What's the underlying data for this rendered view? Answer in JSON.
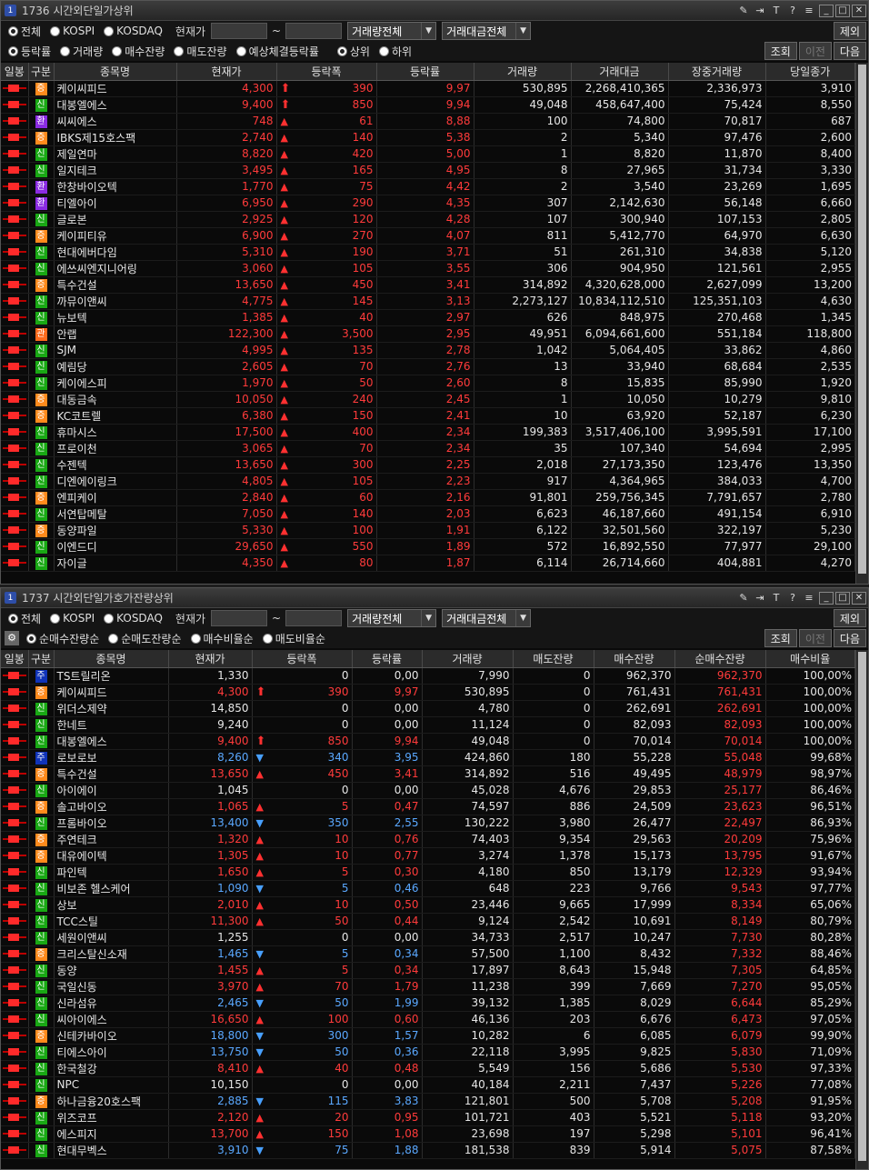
{
  "top": {
    "num": "1",
    "title": "1736 시간외단일가상위",
    "radios": [
      "전체",
      "KOSPI",
      "KOSDAQ"
    ],
    "price_label": "현재가",
    "tilde": "~",
    "sel1": "거래량전체",
    "sel2": "거래대금전체",
    "btn_exclude": "제외",
    "radios2": [
      "등락률",
      "거래량",
      "매수잔량",
      "매도잔량",
      "예상체결등락률"
    ],
    "radios3": [
      "상위",
      "하위"
    ],
    "btn_query": "조회",
    "btn_prev": "이전",
    "btn_next": "다음",
    "headers": [
      "일봉",
      "구분",
      "종목명",
      "현재가",
      "등락폭",
      "등락률",
      "거래량",
      "거래대금",
      "장중거래량",
      "당일종가"
    ],
    "rows": [
      [
        "증",
        "케이씨피드",
        "4,300",
        "up2",
        "390",
        "9,97",
        "530,895",
        "2,268,410,365",
        "2,336,973",
        "3,910"
      ],
      [
        "신",
        "대봉엘에스",
        "9,400",
        "up2",
        "850",
        "9,94",
        "49,048",
        "458,647,400",
        "75,424",
        "8,550"
      ],
      [
        "환",
        "씨씨에스",
        "748",
        "up",
        "61",
        "8,88",
        "100",
        "74,800",
        "70,817",
        "687"
      ],
      [
        "증",
        "IBKS제15호스팩",
        "2,740",
        "up",
        "140",
        "5,38",
        "2",
        "5,340",
        "97,476",
        "2,600"
      ],
      [
        "신",
        "제일연마",
        "8,820",
        "up",
        "420",
        "5,00",
        "1",
        "8,820",
        "11,870",
        "8,400"
      ],
      [
        "신",
        "일지테크",
        "3,495",
        "up",
        "165",
        "4,95",
        "8",
        "27,965",
        "31,734",
        "3,330"
      ],
      [
        "환",
        "한창바이오텍",
        "1,770",
        "up",
        "75",
        "4,42",
        "2",
        "3,540",
        "23,269",
        "1,695"
      ],
      [
        "환",
        "티엘아이",
        "6,950",
        "up",
        "290",
        "4,35",
        "307",
        "2,142,630",
        "56,148",
        "6,660"
      ],
      [
        "신",
        "글로본",
        "2,925",
        "up",
        "120",
        "4,28",
        "107",
        "300,940",
        "107,153",
        "2,805"
      ],
      [
        "증",
        "케이피티유",
        "6,900",
        "up",
        "270",
        "4,07",
        "811",
        "5,412,770",
        "64,970",
        "6,630"
      ],
      [
        "신",
        "현대에버다임",
        "5,310",
        "up",
        "190",
        "3,71",
        "51",
        "261,310",
        "34,838",
        "5,120"
      ],
      [
        "신",
        "에쓰씨엔지니어링",
        "3,060",
        "up",
        "105",
        "3,55",
        "306",
        "904,950",
        "121,561",
        "2,955"
      ],
      [
        "증",
        "특수건설",
        "13,650",
        "up",
        "450",
        "3,41",
        "314,892",
        "4,320,628,000",
        "2,627,099",
        "13,200"
      ],
      [
        "신",
        "까뮤이앤씨",
        "4,775",
        "up",
        "145",
        "3,13",
        "2,273,127",
        "10,834,112,510",
        "125,351,103",
        "4,630"
      ],
      [
        "신",
        "뉴보텍",
        "1,385",
        "up",
        "40",
        "2,97",
        "626",
        "848,975",
        "270,468",
        "1,345"
      ],
      [
        "관",
        "안랩",
        "122,300",
        "up",
        "3,500",
        "2,95",
        "49,951",
        "6,094,661,600",
        "551,184",
        "118,800"
      ],
      [
        "신",
        "SJM",
        "4,995",
        "up",
        "135",
        "2,78",
        "1,042",
        "5,064,405",
        "33,862",
        "4,860"
      ],
      [
        "신",
        "예림당",
        "2,605",
        "up",
        "70",
        "2,76",
        "13",
        "33,940",
        "68,684",
        "2,535"
      ],
      [
        "신",
        "케이에스피",
        "1,970",
        "up",
        "50",
        "2,60",
        "8",
        "15,835",
        "85,990",
        "1,920"
      ],
      [
        "증",
        "대동금속",
        "10,050",
        "up",
        "240",
        "2,45",
        "1",
        "10,050",
        "10,279",
        "9,810"
      ],
      [
        "증",
        "KC코트렐",
        "6,380",
        "up",
        "150",
        "2,41",
        "10",
        "63,920",
        "52,187",
        "6,230"
      ],
      [
        "신",
        "휴마시스",
        "17,500",
        "up",
        "400",
        "2,34",
        "199,383",
        "3,517,406,100",
        "3,995,591",
        "17,100"
      ],
      [
        "신",
        "프로이천",
        "3,065",
        "up",
        "70",
        "2,34",
        "35",
        "107,340",
        "54,694",
        "2,995"
      ],
      [
        "신",
        "수젠텍",
        "13,650",
        "up",
        "300",
        "2,25",
        "2,018",
        "27,173,350",
        "123,476",
        "13,350"
      ],
      [
        "신",
        "디엔에이링크",
        "4,805",
        "up",
        "105",
        "2,23",
        "917",
        "4,364,965",
        "384,033",
        "4,700"
      ],
      [
        "증",
        "엔피케이",
        "2,840",
        "up",
        "60",
        "2,16",
        "91,801",
        "259,756,345",
        "7,791,657",
        "2,780"
      ],
      [
        "신",
        "서연탑메탈",
        "7,050",
        "up",
        "140",
        "2,03",
        "6,623",
        "46,187,660",
        "491,154",
        "6,910"
      ],
      [
        "증",
        "동양파일",
        "5,330",
        "up",
        "100",
        "1,91",
        "6,122",
        "32,501,560",
        "322,197",
        "5,230"
      ],
      [
        "신",
        "이엔드디",
        "29,650",
        "up",
        "550",
        "1,89",
        "572",
        "16,892,550",
        "77,977",
        "29,100"
      ],
      [
        "신",
        "자이글",
        "4,350",
        "up",
        "80",
        "1,87",
        "6,114",
        "26,714,660",
        "404,881",
        "4,270"
      ]
    ]
  },
  "bottom": {
    "num": "1",
    "title": "1737 시간외단일가호가잔량상위",
    "radios": [
      "전체",
      "KOSPI",
      "KOSDAQ"
    ],
    "price_label": "현재가",
    "tilde": "~",
    "sel1": "거래량전체",
    "sel2": "거래대금전체",
    "btn_exclude": "제외",
    "radios2": [
      "순매수잔량순",
      "순매도잔량순",
      "매수비율순",
      "매도비율순"
    ],
    "btn_query": "조회",
    "btn_prev": "이전",
    "btn_next": "다음",
    "headers": [
      "일봉",
      "구분",
      "종목명",
      "현재가",
      "등락폭",
      "등락률",
      "거래량",
      "매도잔량",
      "매수잔량",
      "순매수잔량",
      "매수비율"
    ],
    "rows": [
      [
        "주",
        "TS트릴리온",
        "1,330",
        "",
        "0",
        "0,00",
        "7,990",
        "0",
        "962,370",
        "962,370",
        "100,00%"
      ],
      [
        "증",
        "케이씨피드",
        "4,300",
        "up2",
        "390",
        "9,97",
        "530,895",
        "0",
        "761,431",
        "761,431",
        "100,00%"
      ],
      [
        "신",
        "위더스제약",
        "14,850",
        "",
        "0",
        "0,00",
        "4,780",
        "0",
        "262,691",
        "262,691",
        "100,00%"
      ],
      [
        "신",
        "한네트",
        "9,240",
        "",
        "0",
        "0,00",
        "11,124",
        "0",
        "82,093",
        "82,093",
        "100,00%"
      ],
      [
        "신",
        "대봉엘에스",
        "9,400",
        "up2",
        "850",
        "9,94",
        "49,048",
        "0",
        "70,014",
        "70,014",
        "100,00%"
      ],
      [
        "주",
        "로보로보",
        "8,260",
        "dn",
        "340",
        "3,95",
        "424,860",
        "180",
        "55,228",
        "55,048",
        "99,68%"
      ],
      [
        "증",
        "특수건설",
        "13,650",
        "up",
        "450",
        "3,41",
        "314,892",
        "516",
        "49,495",
        "48,979",
        "98,97%"
      ],
      [
        "신",
        "아이에이",
        "1,045",
        "",
        "0",
        "0,00",
        "45,028",
        "4,676",
        "29,853",
        "25,177",
        "86,46%"
      ],
      [
        "증",
        "솔고바이오",
        "1,065",
        "up",
        "5",
        "0,47",
        "74,597",
        "886",
        "24,509",
        "23,623",
        "96,51%"
      ],
      [
        "신",
        "프롬바이오",
        "13,400",
        "dn",
        "350",
        "2,55",
        "130,222",
        "3,980",
        "26,477",
        "22,497",
        "86,93%"
      ],
      [
        "증",
        "주연테크",
        "1,320",
        "up",
        "10",
        "0,76",
        "74,403",
        "9,354",
        "29,563",
        "20,209",
        "75,96%"
      ],
      [
        "증",
        "대유에이텍",
        "1,305",
        "up",
        "10",
        "0,77",
        "3,274",
        "1,378",
        "15,173",
        "13,795",
        "91,67%"
      ],
      [
        "신",
        "파인텍",
        "1,650",
        "up",
        "5",
        "0,30",
        "4,180",
        "850",
        "13,179",
        "12,329",
        "93,94%"
      ],
      [
        "신",
        "비보존 헬스케어",
        "1,090",
        "dn",
        "5",
        "0,46",
        "648",
        "223",
        "9,766",
        "9,543",
        "97,77%"
      ],
      [
        "신",
        "상보",
        "2,010",
        "up",
        "10",
        "0,50",
        "23,446",
        "9,665",
        "17,999",
        "8,334",
        "65,06%"
      ],
      [
        "신",
        "TCC스틸",
        "11,300",
        "up",
        "50",
        "0,44",
        "9,124",
        "2,542",
        "10,691",
        "8,149",
        "80,79%"
      ],
      [
        "신",
        "세원이앤씨",
        "1,255",
        "",
        "0",
        "0,00",
        "34,733",
        "2,517",
        "10,247",
        "7,730",
        "80,28%"
      ],
      [
        "증",
        "크리스탈신소재",
        "1,465",
        "dn",
        "5",
        "0,34",
        "57,500",
        "1,100",
        "8,432",
        "7,332",
        "88,46%"
      ],
      [
        "신",
        "동양",
        "1,455",
        "up",
        "5",
        "0,34",
        "17,897",
        "8,643",
        "15,948",
        "7,305",
        "64,85%"
      ],
      [
        "신",
        "국일신동",
        "3,970",
        "up",
        "70",
        "1,79",
        "11,238",
        "399",
        "7,669",
        "7,270",
        "95,05%"
      ],
      [
        "신",
        "신라섬유",
        "2,465",
        "dn",
        "50",
        "1,99",
        "39,132",
        "1,385",
        "8,029",
        "6,644",
        "85,29%"
      ],
      [
        "신",
        "씨아이에스",
        "16,650",
        "up",
        "100",
        "0,60",
        "46,136",
        "203",
        "6,676",
        "6,473",
        "97,05%"
      ],
      [
        "증",
        "신테카바이오",
        "18,800",
        "dn",
        "300",
        "1,57",
        "10,282",
        "6",
        "6,085",
        "6,079",
        "99,90%"
      ],
      [
        "신",
        "티에스아이",
        "13,750",
        "dn",
        "50",
        "0,36",
        "22,118",
        "3,995",
        "9,825",
        "5,830",
        "71,09%"
      ],
      [
        "신",
        "한국철강",
        "8,410",
        "up",
        "40",
        "0,48",
        "5,549",
        "156",
        "5,686",
        "5,530",
        "97,33%"
      ],
      [
        "신",
        "NPC",
        "10,150",
        "",
        "0",
        "0,00",
        "40,184",
        "2,211",
        "7,437",
        "5,226",
        "77,08%"
      ],
      [
        "증",
        "하나금융20호스팩",
        "2,885",
        "dn",
        "115",
        "3,83",
        "121,801",
        "500",
        "5,708",
        "5,208",
        "91,95%"
      ],
      [
        "신",
        "위즈코프",
        "2,120",
        "up",
        "20",
        "0,95",
        "101,721",
        "403",
        "5,521",
        "5,118",
        "93,20%"
      ],
      [
        "신",
        "에스피지",
        "13,700",
        "up",
        "150",
        "1,08",
        "23,698",
        "197",
        "5,298",
        "5,101",
        "96,41%"
      ],
      [
        "신",
        "현대무벡스",
        "3,910",
        "dn",
        "75",
        "1,88",
        "181,538",
        "839",
        "5,914",
        "5,075",
        "87,58%"
      ]
    ]
  },
  "colors": {
    "up": "#ff3b3b",
    "down": "#5aa8ff",
    "bg": "#0a0a0a"
  },
  "icons": [
    "pin-icon",
    "export-icon",
    "font-icon",
    "help-icon",
    "menu-icon",
    "minimize-icon",
    "maximize-icon",
    "close-icon",
    "gear-icon",
    "arrow-up-icon",
    "triangle-up-icon",
    "triangle-down-icon"
  ]
}
